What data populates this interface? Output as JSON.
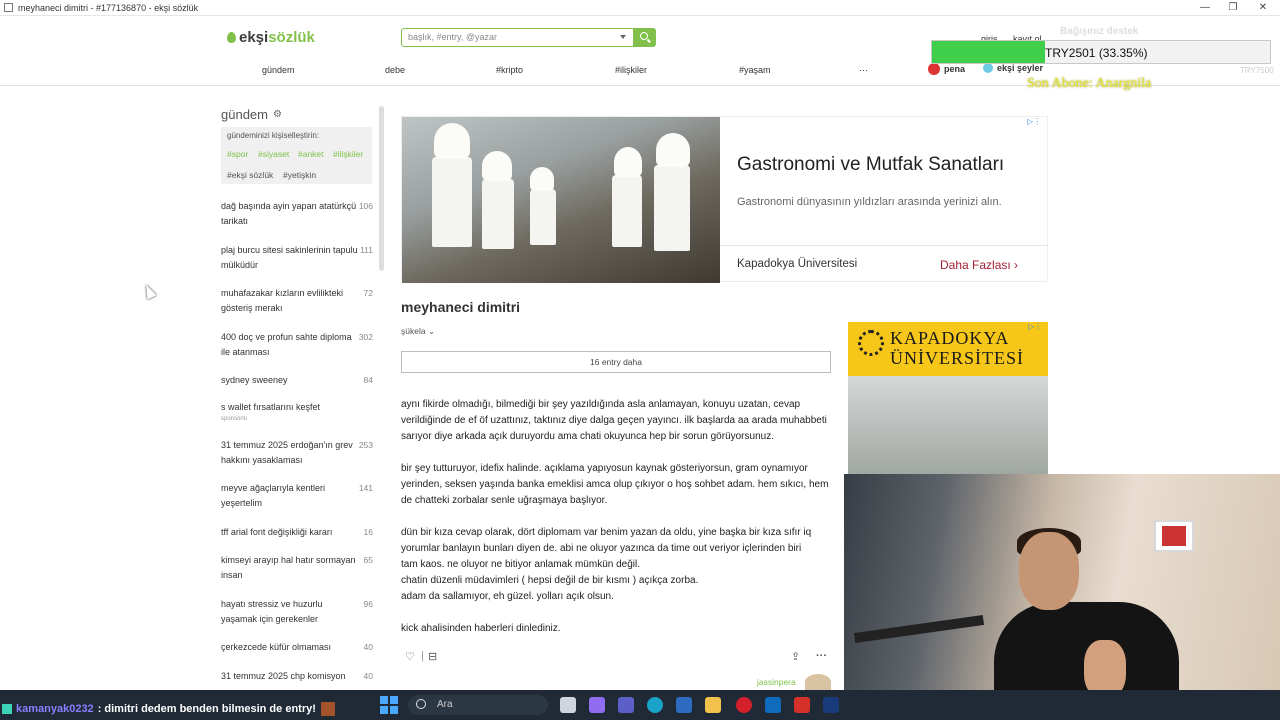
{
  "window": {
    "title": "meyhaneci dimitri - #177136870 - ekşi sözlük",
    "minimize": "—",
    "maximize": "❐",
    "close": "✕"
  },
  "header": {
    "logo_a": "ekşi",
    "logo_b": "sözlük",
    "search_placeholder": "başlık, #entry, @yazar",
    "nav": [
      "gündem",
      "debe",
      "#kripto",
      "#ilişkiler",
      "#yaşam",
      "···"
    ],
    "login": "giriş",
    "register": "kayıt ol",
    "pena": "pena",
    "eksi_seyler": "ekşi şeyler"
  },
  "overlay": {
    "donation_title": "Bağışınız destek",
    "progress_label": "TRY2501 (33.35%)",
    "progress_fraction": 0.3335,
    "progress_right": "TRY7500",
    "last_sub": "Son Abone: Anargnila",
    "progress_color": "#3fcf4b"
  },
  "sidebar": {
    "title": "gündem",
    "personalize": "gündeminizi kişiselleştirin:",
    "tags_green": [
      "#spor",
      "#siyaset",
      "#anket",
      "#ilişkiler"
    ],
    "tags_gray": [
      "#ekşi sözlük",
      "#yetişkin"
    ],
    "topics": [
      {
        "title": "dağ başında ayin yapan atatürkçü tarikatı",
        "count": "106"
      },
      {
        "title": "plaj burcu sitesi sakinlerinin tapulu mülküdür",
        "count": "111"
      },
      {
        "title": "muhafazakar kızların evlilikteki gösteriş merakı",
        "count": "72"
      },
      {
        "title": "400 doç ve profun sahte diploma ile atanması",
        "count": "302"
      },
      {
        "title": "sydney sweeney",
        "count": "84"
      },
      {
        "title": "s wallet fırsatlarını keşfet",
        "count": ""
      },
      {
        "title": "31 temmuz 2025 erdoğan'ın grev hakkını yasaklaması",
        "count": "253"
      },
      {
        "title": "meyve ağaçlarıyla kentleri yeşertelim",
        "count": "141"
      },
      {
        "title": "tff arial font değişikliği kararı",
        "count": "16"
      },
      {
        "title": "kimseyi arayıp hal hatır sormayan insan",
        "count": "65"
      },
      {
        "title": "hayatı stressiz ve huzurlu yaşamak için gerekenler",
        "count": "96"
      },
      {
        "title": "çerkezcede küfür olmaması",
        "count": "40"
      },
      {
        "title": "31 temmuz 2025 chp komisyon",
        "count": "40"
      }
    ],
    "sponsored": "sponsorlu"
  },
  "ad_top": {
    "title": "Gastronomi ve Mutfak Sanatları",
    "subtitle": "Gastronomi dünyasının yıldızları arasında yerinizi alın.",
    "brand": "Kapadokya Üniversitesi",
    "cta": "Daha Fazlası"
  },
  "ad_side": {
    "line1": "KAPADOKYA",
    "line2": "ÜNİVERSİTESİ"
  },
  "entry": {
    "title": "meyhaneci dimitri",
    "sort": "şükela",
    "more": "16 entry daha",
    "paragraphs": [
      "aynı fikirde olmadığı, bilmediği bir şey yazıldığında asla anlamayan, konuyu uzatan, cevap verildiğinde de ef öf uzattınız, taktınız diye dalga geçen yayıncı. ilk başlarda aa arada muhabbeti sarıyor diye arkada açık duruyordu ama chati okuyunca hep bir sorun görüyorsunuz.",
      "bir şey tutturuyor, idefix halinde. açıklama yapıyosun kaynak gösteriyorsun, gram oynamıyor yerinden, seksen yaşında banka emeklisi amca olup çıkıyor o hoş sohbet adam. hem sıkıcı, hem de chatteki zorbalar senle uğraşmaya başlıyor.",
      "dün bir kıza cevap olarak, dört diplomam var benim yazan da oldu, yine başka bir kıza sıfır iq yorumlar banlayın bunları diyen de. abi ne oluyor yazınca da time out veriyor içlerinden biri",
      "tam kaos. ne oluyor ne bitiyor anlamak mümkün değil.",
      "chatin düzenli müdavimleri ( hepsi değil de bir kısmı ) açıkça zorba.",
      "adam da sallamıyor, eh güzel. yolları açık olsun.",
      "kick ahalisinden haberleri dinlediniz."
    ],
    "author": "jassinpera"
  },
  "chat": {
    "user": "kamanyak0232",
    "message": ": dimitri dedem benden bilmesin de entry!"
  },
  "taskbar": {
    "search": "Ara"
  }
}
